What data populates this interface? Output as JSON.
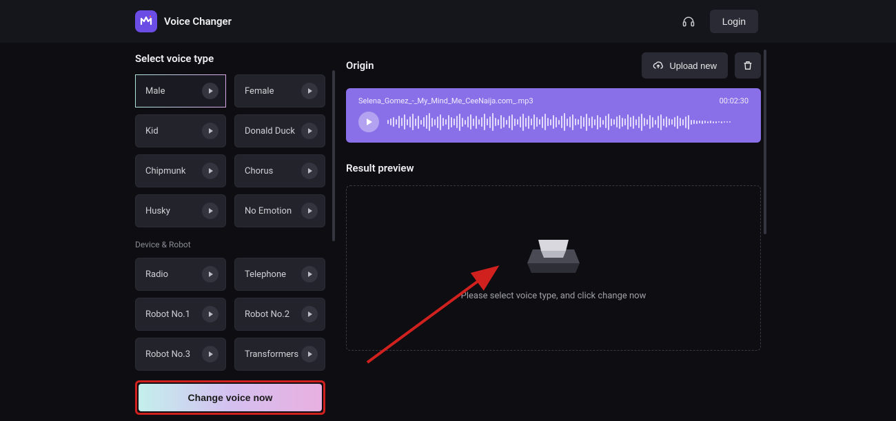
{
  "header": {
    "title": "Voice Changer",
    "login_label": "Login"
  },
  "sidebar": {
    "title": "Select voice type",
    "voices": [
      {
        "label": "Male",
        "selected": true
      },
      {
        "label": "Female",
        "selected": false
      },
      {
        "label": "Kid",
        "selected": false
      },
      {
        "label": "Donald Duck",
        "selected": false
      },
      {
        "label": "Chipmunk",
        "selected": false
      },
      {
        "label": "Chorus",
        "selected": false
      },
      {
        "label": "Husky",
        "selected": false
      },
      {
        "label": "No Emotion",
        "selected": false
      }
    ],
    "group2_label": "Device & Robot",
    "voices2": [
      {
        "label": "Radio"
      },
      {
        "label": "Telephone"
      },
      {
        "label": "Robot No.1"
      },
      {
        "label": "Robot No.2"
      },
      {
        "label": "Robot No.3"
      },
      {
        "label": "Transformers"
      }
    ],
    "change_label": "Change voice now"
  },
  "origin": {
    "title": "Origin",
    "upload_label": "Upload new",
    "filename": "Selena_Gomez_-_My_Mind_Me_CeeNaija.com_.mp3",
    "duration": "00:02:30"
  },
  "result": {
    "title": "Result preview",
    "hint": "Please select voice type, and click change now"
  }
}
